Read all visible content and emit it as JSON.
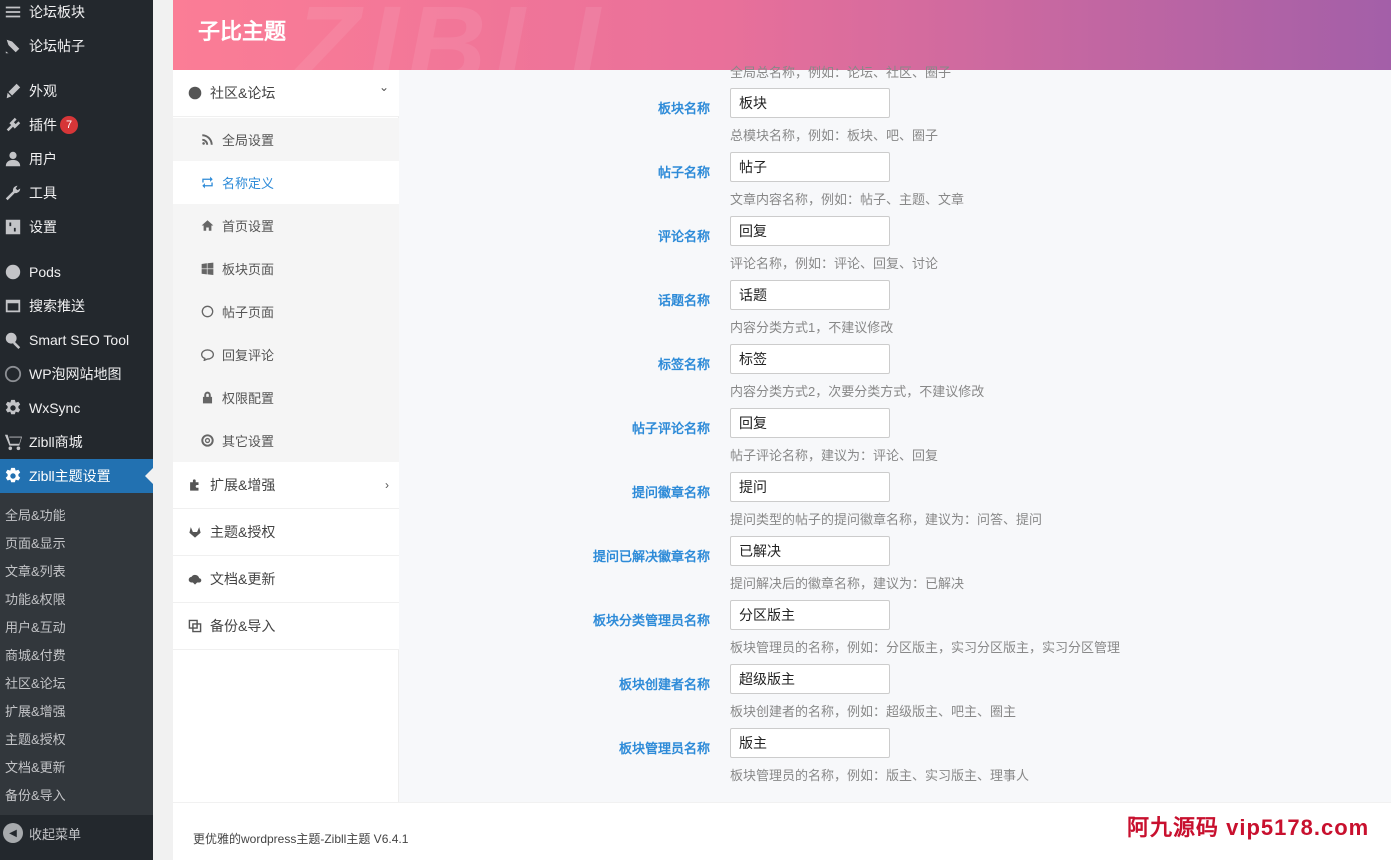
{
  "wp_menu": [
    {
      "label": "论坛板块",
      "icon": "forum-icon"
    },
    {
      "label": "论坛帖子",
      "icon": "posts-icon"
    },
    {
      "label": "外观",
      "icon": "appearance-icon"
    },
    {
      "label": "插件",
      "icon": "plugin-icon",
      "badge": "7"
    },
    {
      "label": "用户",
      "icon": "user-icon"
    },
    {
      "label": "工具",
      "icon": "wrench-icon"
    },
    {
      "label": "设置",
      "icon": "settings-icon"
    },
    {
      "label": "Pods",
      "icon": "pods-icon"
    },
    {
      "label": "搜索推送",
      "icon": "push-icon"
    },
    {
      "label": "Smart SEO Tool",
      "icon": "seo-icon"
    },
    {
      "label": "WP泡网站地图",
      "icon": "sitemap-icon"
    },
    {
      "label": "WxSync",
      "icon": "gear-icon"
    },
    {
      "label": "Zibll商城",
      "icon": "cart-icon"
    },
    {
      "label": "Zibll主题设置",
      "icon": "gear-icon",
      "active": true
    }
  ],
  "wp_submenu": [
    "全局&功能",
    "页面&显示",
    "文章&列表",
    "功能&权限",
    "用户&互动",
    "商城&付费",
    "社区&论坛",
    "扩展&增强",
    "主题&授权",
    "文档&更新",
    "备份&导入"
  ],
  "collapse_label": "收起菜单",
  "header": {
    "title": "子比主题",
    "watermark": "ZIBLL"
  },
  "nav": {
    "groups": [
      {
        "label": "社区&论坛",
        "icon": "dashboard-icon",
        "chevron": "⌄"
      },
      {
        "label": "扩展&增强",
        "icon": "puzzle-icon",
        "chevron": "›"
      },
      {
        "label": "主题&授权",
        "icon": "gitlab-icon"
      },
      {
        "label": "文档&更新",
        "icon": "cloud-download-icon"
      },
      {
        "label": "备份&导入",
        "icon": "copy-icon"
      }
    ],
    "sub_items": [
      {
        "label": "全局设置",
        "icon": "rss-icon"
      },
      {
        "label": "名称定义",
        "icon": "retweet-icon",
        "active": true
      },
      {
        "label": "首页设置",
        "icon": "home-icon"
      },
      {
        "label": "板块页面",
        "icon": "windows-icon"
      },
      {
        "label": "帖子页面",
        "icon": "globe-icon"
      },
      {
        "label": "回复评论",
        "icon": "comment-icon"
      },
      {
        "label": "权限配置",
        "icon": "lock-icon"
      },
      {
        "label": "其它设置",
        "icon": "lifebuoy-icon"
      }
    ]
  },
  "prev_desc": "全局总名称，例如：论坛、社区、圈子",
  "fields": [
    {
      "label": "板块名称",
      "value": "板块",
      "desc": "总模块名称，例如：板块、吧、圈子"
    },
    {
      "label": "帖子名称",
      "value": "帖子",
      "desc": "文章内容名称，例如：帖子、主题、文章"
    },
    {
      "label": "评论名称",
      "value": "回复",
      "desc": "评论名称，例如：评论、回复、讨论"
    },
    {
      "label": "话题名称",
      "value": "话题",
      "desc": "内容分类方式1，不建议修改"
    },
    {
      "label": "标签名称",
      "value": "标签",
      "desc": "内容分类方式2，次要分类方式，不建议修改"
    },
    {
      "label": "帖子评论名称",
      "value": "回复",
      "desc": "帖子评论名称，建议为：评论、回复"
    },
    {
      "label": "提问徽章名称",
      "value": "提问",
      "desc": "提问类型的帖子的提问徽章名称，建议为：问答、提问"
    },
    {
      "label": "提问已解决徽章名称",
      "value": "已解决",
      "desc": "提问解决后的徽章名称，建议为：已解决"
    },
    {
      "label": "板块分类管理员名称",
      "value": "分区版主",
      "desc": "板块管理员的名称，例如：分区版主，实习分区版主，实习分区管理"
    },
    {
      "label": "板块创建者名称",
      "value": "超级版主",
      "desc": "板块创建者的名称，例如：超级版主、吧主、圈主"
    },
    {
      "label": "板块管理员名称",
      "value": "版主",
      "desc": "板块管理员的名称，例如：版主、实习版主、理事人"
    }
  ],
  "footer": {
    "text": "更优雅的wordpress主题-Zibll主题 V6.4.1",
    "brand": "阿九源码  vip5178.com"
  }
}
